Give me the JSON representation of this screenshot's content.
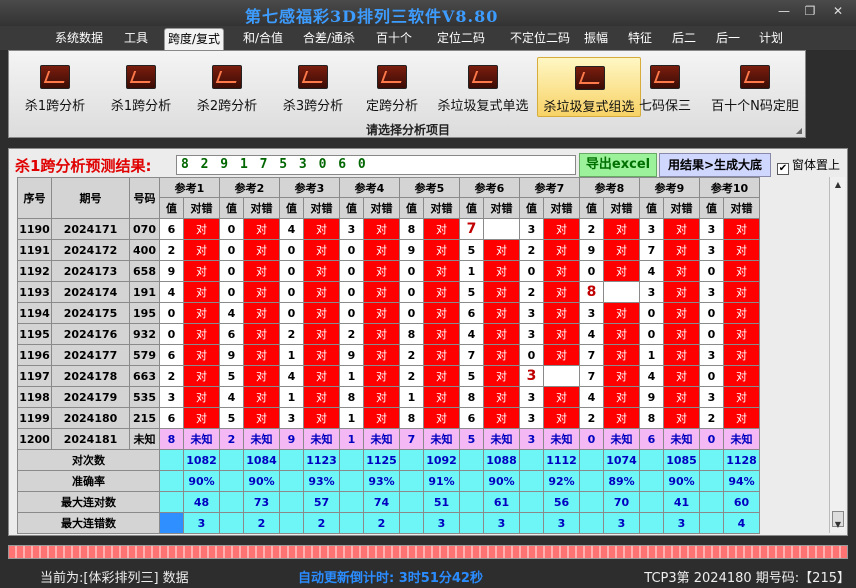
{
  "app": {
    "title": "第七感福彩3D排列三软件V8.80",
    "minimize": "—",
    "restore": "❐",
    "close": "✕"
  },
  "menu": [
    "系统数据",
    "工具",
    "跨度/复式",
    "和/合值",
    "合差/通杀",
    "百十个",
    "定位二码",
    "不定位二码",
    "振幅",
    "特征",
    "后二",
    "后一",
    "计划"
  ],
  "menu_active_index": 2,
  "ribbon": {
    "tools": [
      "杀1跨分析",
      "杀1跨分析",
      "杀2跨分析",
      "杀3跨分析",
      "定跨分析",
      "杀垃圾复式单选",
      "杀垃圾复式组选",
      "七码保三",
      "百十个N码定胆"
    ],
    "selected_index": 6,
    "group_label": "请选择分析项目"
  },
  "prediction": {
    "label": "杀1跨分析预测结果:",
    "value": "8 2 9 1 7 5 3 0 6 0",
    "export_button": "导出excel",
    "generate_button": "用结果>生成大底",
    "ontop_label": "窗体置上",
    "ontop_checked": true,
    "check_mark": "✔"
  },
  "grid": {
    "headers": {
      "seq": "序号",
      "period": "期号",
      "code": "号码",
      "refs": [
        "参考1",
        "参考2",
        "参考3",
        "参考4",
        "参考5",
        "参考6",
        "参考7",
        "参考8",
        "参考9",
        "参考10"
      ],
      "value": "值",
      "result": "对错"
    },
    "rows": [
      {
        "seq": "1190",
        "period": "2024171",
        "code": "070",
        "cells": [
          [
            "6",
            "对"
          ],
          [
            "0",
            "对"
          ],
          [
            "4",
            "对"
          ],
          [
            "3",
            "对"
          ],
          [
            "8",
            "对"
          ],
          [
            "7",
            ""
          ],
          [
            "3",
            "对"
          ],
          [
            "2",
            "对"
          ],
          [
            "3",
            "对"
          ],
          [
            "3",
            "对"
          ]
        ]
      },
      {
        "seq": "1191",
        "period": "2024172",
        "code": "400",
        "cells": [
          [
            "2",
            "对"
          ],
          [
            "0",
            "对"
          ],
          [
            "0",
            "对"
          ],
          [
            "0",
            "对"
          ],
          [
            "9",
            "对"
          ],
          [
            "5",
            "对"
          ],
          [
            "2",
            "对"
          ],
          [
            "9",
            "对"
          ],
          [
            "7",
            "对"
          ],
          [
            "3",
            "对"
          ]
        ]
      },
      {
        "seq": "1192",
        "period": "2024173",
        "code": "658",
        "cells": [
          [
            "9",
            "对"
          ],
          [
            "0",
            "对"
          ],
          [
            "0",
            "对"
          ],
          [
            "0",
            "对"
          ],
          [
            "0",
            "对"
          ],
          [
            "1",
            "对"
          ],
          [
            "0",
            "对"
          ],
          [
            "0",
            "对"
          ],
          [
            "4",
            "对"
          ],
          [
            "0",
            "对"
          ]
        ]
      },
      {
        "seq": "1193",
        "period": "2024174",
        "code": "191",
        "cells": [
          [
            "4",
            "对"
          ],
          [
            "0",
            "对"
          ],
          [
            "0",
            "对"
          ],
          [
            "0",
            "对"
          ],
          [
            "0",
            "对"
          ],
          [
            "5",
            "对"
          ],
          [
            "2",
            "对"
          ],
          [
            "8",
            ""
          ],
          [
            "3",
            "对"
          ],
          [
            "3",
            "对"
          ]
        ]
      },
      {
        "seq": "1194",
        "period": "2024175",
        "code": "195",
        "cells": [
          [
            "0",
            "对"
          ],
          [
            "4",
            "对"
          ],
          [
            "0",
            "对"
          ],
          [
            "0",
            "对"
          ],
          [
            "0",
            "对"
          ],
          [
            "6",
            "对"
          ],
          [
            "3",
            "对"
          ],
          [
            "3",
            "对"
          ],
          [
            "0",
            "对"
          ],
          [
            "0",
            "对"
          ]
        ]
      },
      {
        "seq": "1195",
        "period": "2024176",
        "code": "932",
        "cells": [
          [
            "0",
            "对"
          ],
          [
            "6",
            "对"
          ],
          [
            "2",
            "对"
          ],
          [
            "2",
            "对"
          ],
          [
            "8",
            "对"
          ],
          [
            "4",
            "对"
          ],
          [
            "3",
            "对"
          ],
          [
            "4",
            "对"
          ],
          [
            "0",
            "对"
          ],
          [
            "0",
            "对"
          ]
        ]
      },
      {
        "seq": "1196",
        "period": "2024177",
        "code": "579",
        "cells": [
          [
            "6",
            "对"
          ],
          [
            "9",
            "对"
          ],
          [
            "1",
            "对"
          ],
          [
            "9",
            "对"
          ],
          [
            "2",
            "对"
          ],
          [
            "7",
            "对"
          ],
          [
            "0",
            "对"
          ],
          [
            "7",
            "对"
          ],
          [
            "1",
            "对"
          ],
          [
            "3",
            "对"
          ]
        ]
      },
      {
        "seq": "1197",
        "period": "2024178",
        "code": "663",
        "cells": [
          [
            "2",
            "对"
          ],
          [
            "5",
            "对"
          ],
          [
            "4",
            "对"
          ],
          [
            "1",
            "对"
          ],
          [
            "2",
            "对"
          ],
          [
            "5",
            "对"
          ],
          [
            "3",
            ""
          ],
          [
            "7",
            "对"
          ],
          [
            "4",
            "对"
          ],
          [
            "0",
            "对"
          ]
        ]
      },
      {
        "seq": "1198",
        "period": "2024179",
        "code": "535",
        "cells": [
          [
            "3",
            "对"
          ],
          [
            "4",
            "对"
          ],
          [
            "1",
            "对"
          ],
          [
            "8",
            "对"
          ],
          [
            "1",
            "对"
          ],
          [
            "8",
            "对"
          ],
          [
            "3",
            "对"
          ],
          [
            "4",
            "对"
          ],
          [
            "9",
            "对"
          ],
          [
            "3",
            "对"
          ]
        ]
      },
      {
        "seq": "1199",
        "period": "2024180",
        "code": "215",
        "cells": [
          [
            "6",
            "对"
          ],
          [
            "5",
            "对"
          ],
          [
            "3",
            "对"
          ],
          [
            "1",
            "对"
          ],
          [
            "8",
            "对"
          ],
          [
            "6",
            "对"
          ],
          [
            "3",
            "对"
          ],
          [
            "2",
            "对"
          ],
          [
            "8",
            "对"
          ],
          [
            "2",
            "对"
          ]
        ]
      }
    ],
    "pending": {
      "seq": "1200",
      "period": "2024181",
      "code": "未知",
      "cells": [
        [
          "8",
          "未知"
        ],
        [
          "2",
          "未知"
        ],
        [
          "9",
          "未知"
        ],
        [
          "1",
          "未知"
        ],
        [
          "7",
          "未知"
        ],
        [
          "5",
          "未知"
        ],
        [
          "3",
          "未知"
        ],
        [
          "0",
          "未知"
        ],
        [
          "6",
          "未知"
        ],
        [
          "0",
          "未知"
        ]
      ]
    },
    "stats": [
      {
        "label": "对次数",
        "values": [
          "1082",
          "1084",
          "1123",
          "1125",
          "1092",
          "1088",
          "1112",
          "1074",
          "1085",
          "1128"
        ]
      },
      {
        "label": "准确率",
        "values": [
          "90%",
          "90%",
          "93%",
          "93%",
          "91%",
          "90%",
          "92%",
          "89%",
          "90%",
          "94%"
        ]
      },
      {
        "label": "最大连对数",
        "values": [
          "48",
          "73",
          "57",
          "74",
          "51",
          "61",
          "56",
          "70",
          "41",
          "60"
        ]
      },
      {
        "label": "最大连错数",
        "values": [
          "3",
          "2",
          "2",
          "2",
          "3",
          "3",
          "3",
          "3",
          "3",
          "4"
        ]
      }
    ]
  },
  "scrollbar": {
    "up": "▲",
    "down": "▼"
  },
  "status": {
    "current": "当前为:[体彩排列三] 数据",
    "countdown": "自动更新倒计时: 3时51分42秒",
    "right": "TCP3第 2024180 期号码:【215】"
  },
  "colors": {
    "hit": "#ff0000",
    "pending": "#f4b8f4",
    "stats": "#6ef6f6",
    "accent": "#3d9cff"
  }
}
